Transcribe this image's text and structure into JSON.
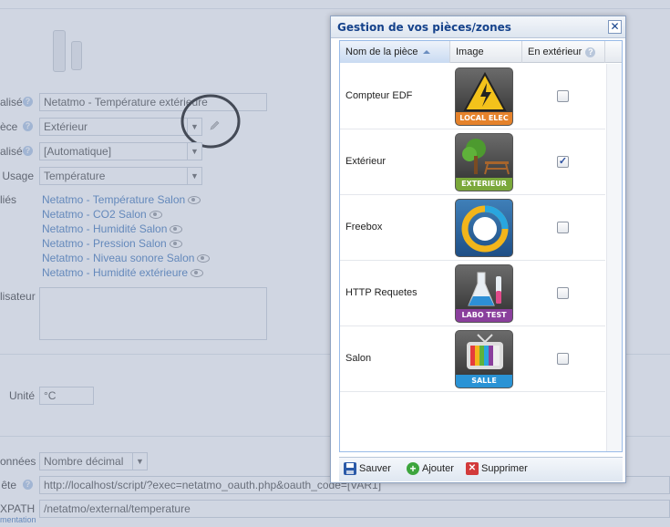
{
  "background": {
    "form": {
      "name_label": "alisé",
      "name_value": "Netatmo - Température extérieure",
      "room_label": "èce",
      "room_value": "Extérieur",
      "display_label": "alisé",
      "display_value": "[Automatique]",
      "usage_label": "Usage",
      "usage_value": "Température",
      "linked_label": "liés",
      "linked_items": [
        "Netatmo - Température Salon",
        "Netatmo - CO2 Salon",
        "Netatmo - Humidité Salon",
        "Netatmo - Pression Salon",
        "Netatmo - Niveau sonore Salon",
        "Netatmo - Humidité extérieure"
      ],
      "user_label": "lisateur",
      "unit_label": "Unité",
      "unit_value": "°C",
      "datatype_label": "onnées",
      "datatype_value": "Nombre décimal",
      "request_label": "ête",
      "request_value": "http://localhost/script/?exec=netatmo_oauth.php&oauth_code=[VAR1]",
      "xpath_label": "XPATH",
      "xpath_sub": "mentation",
      "xpath_value": "/netatmo/external/temperature"
    }
  },
  "dialog": {
    "title": "Gestion de vos pièces/zones",
    "close_glyph": "✕",
    "columns": {
      "name": "Nom de la pièce",
      "image": "Image",
      "outdoor": "En extérieur"
    },
    "rows": [
      {
        "name": "Compteur EDF",
        "tile_label": "LOCAL ELEC",
        "outdoor": false,
        "icon": "electricity-icon"
      },
      {
        "name": "Extérieur",
        "tile_label": "EXTERIEUR",
        "outdoor": true,
        "icon": "garden-icon"
      },
      {
        "name": "Freebox",
        "tile_label": "",
        "outdoor": false,
        "icon": "freebox-icon"
      },
      {
        "name": "HTTP Requetes",
        "tile_label": "LABO TEST",
        "outdoor": false,
        "icon": "lab-flask-icon"
      },
      {
        "name": "Salon",
        "tile_label": "SALLE",
        "outdoor": false,
        "icon": "tv-icon"
      }
    ],
    "toolbar": {
      "save": "Sauver",
      "add": "Ajouter",
      "delete": "Supprimer"
    }
  },
  "colors": {
    "accent": "#15428b",
    "link": "#3a72b8",
    "overlay": "#96a5be"
  }
}
